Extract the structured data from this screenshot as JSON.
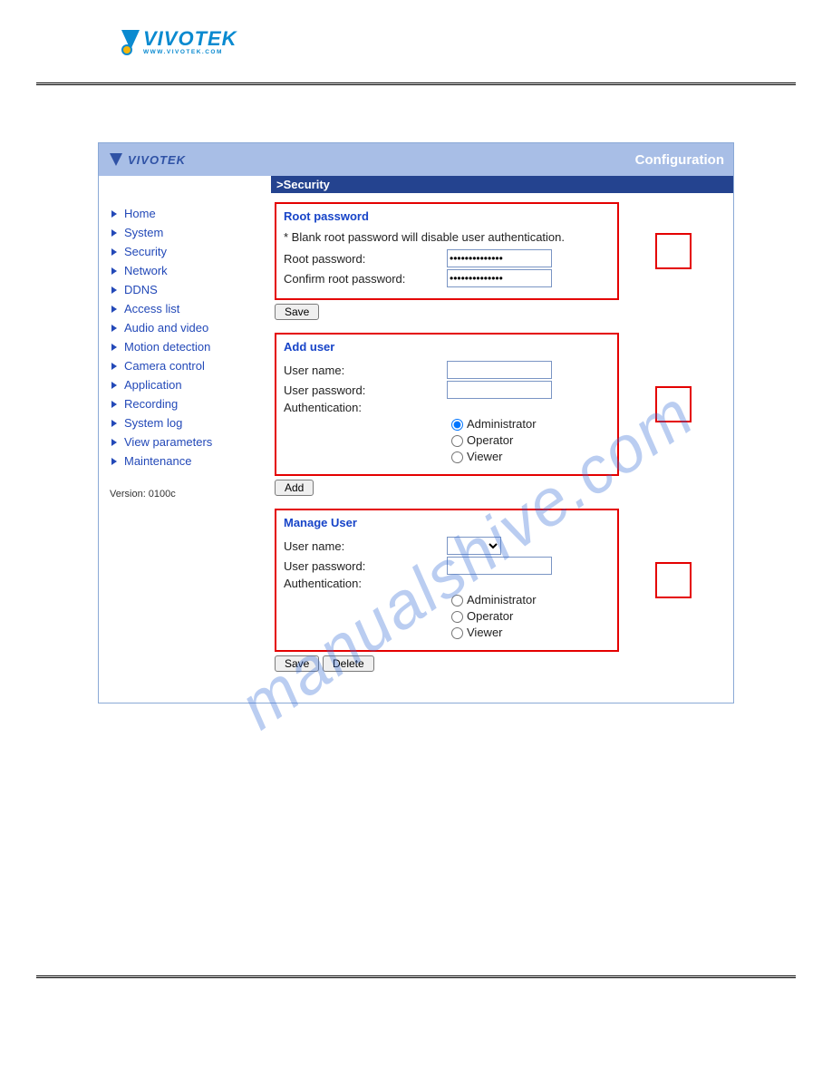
{
  "watermark": "manualshive.com",
  "brand": {
    "logo_text": "VIVOTEK",
    "logo_url": "WWW.VIVOTEK.COM"
  },
  "app": {
    "logo_text": "VIVOTEK",
    "config_label": "Configuration",
    "section_title": ">Security",
    "version_label": "Version: 0100c"
  },
  "nav": [
    "Home",
    "System",
    "Security",
    "Network",
    "DDNS",
    "Access list",
    "Audio and video",
    "Motion detection",
    "Camera control",
    "Application",
    "Recording",
    "System log",
    "View parameters",
    "Maintenance"
  ],
  "root_password": {
    "legend": "Root password",
    "note": "* Blank root password will disable user authentication.",
    "pw_label": "Root password:",
    "pw_value": "••••••••••••••",
    "confirm_label": "Confirm root password:",
    "confirm_value": "••••••••••••••",
    "save_btn": "Save"
  },
  "add_user": {
    "legend": "Add user",
    "username_label": "User name:",
    "password_label": "User password:",
    "auth_label": "Authentication:",
    "roles": [
      "Administrator",
      "Operator",
      "Viewer"
    ],
    "selected_role": "Administrator",
    "add_btn": "Add"
  },
  "manage_user": {
    "legend": "Manage User",
    "username_label": "User name:",
    "password_label": "User password:",
    "auth_label": "Authentication:",
    "roles": [
      "Administrator",
      "Operator",
      "Viewer"
    ],
    "save_btn": "Save",
    "delete_btn": "Delete"
  }
}
